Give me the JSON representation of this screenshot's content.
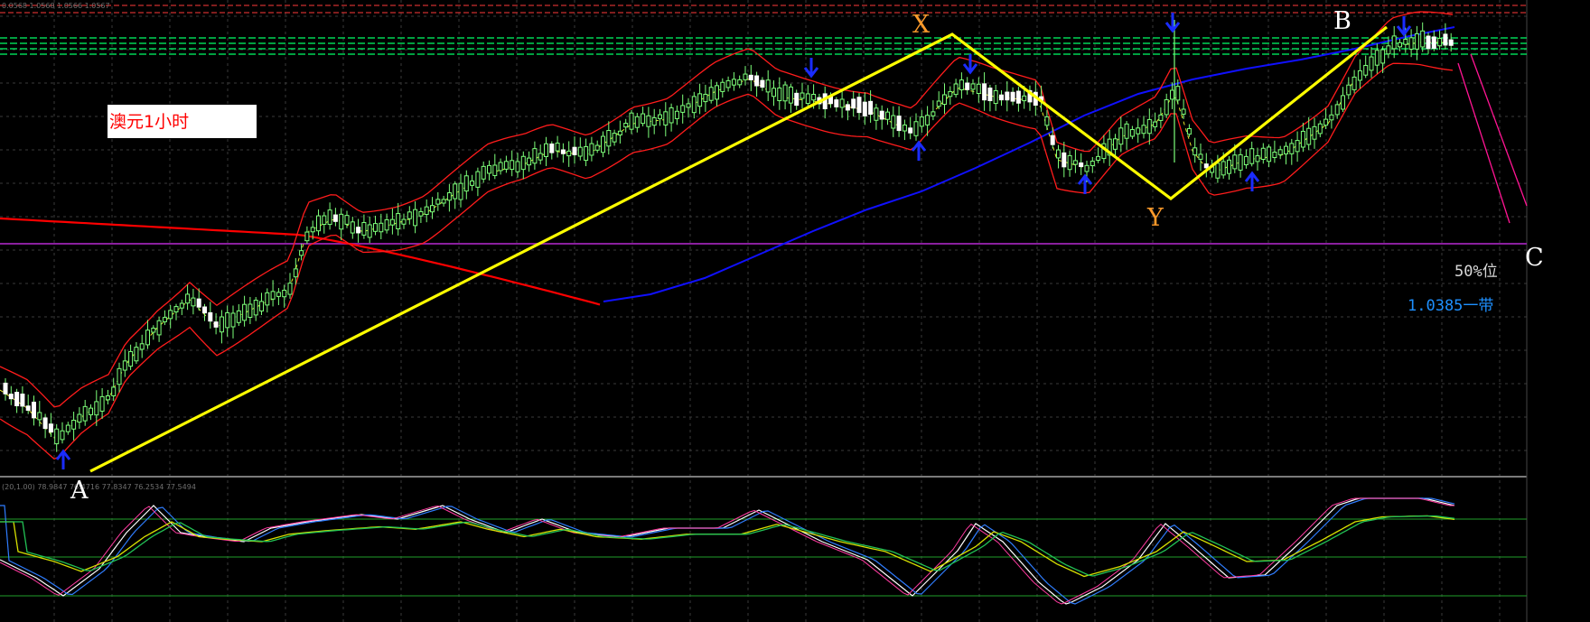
{
  "title": "澳元1小时",
  "header_values": "0.0568 1.0568 1.0566 1.0567",
  "indicator_header": "(20,1.00) 78.9847 76.4716 77.8347 76.2534 77.5494",
  "points": [
    {
      "label": "A",
      "color": "#ffffff"
    },
    {
      "label": "X",
      "color": "#ff9b2b"
    },
    {
      "label": "Y",
      "color": "#ff9b2b"
    },
    {
      "label": "B",
      "color": "#ffffff"
    },
    {
      "label": "C",
      "color": "#ffffff"
    }
  ],
  "notes": [
    {
      "text": "50%位",
      "color": "#d8d8d8"
    },
    {
      "text": "1.0385一带",
      "color": "#1e90ff"
    }
  ],
  "colors": {
    "background": "#000000",
    "bull_candle": "#7dff7a",
    "bear_candle": "#ffffff",
    "pattern_line": "#ffff00",
    "ma_long": "#ff0000",
    "ma_mid": "#1010ff",
    "band": "#ff1c1c",
    "projection": "#ff1493",
    "level_line": "#00ff66",
    "level_line_top": "#ff3a3a",
    "horizontal_50": "#8a1f9e",
    "arrow": "#1a2cff"
  },
  "chart_data": {
    "type": "candlestick",
    "instrument": "澳元",
    "timeframe": "1小时",
    "price_labels": {
      "mid_level": "1.0385"
    },
    "pattern": [
      "A",
      "X",
      "Y",
      "B",
      "C"
    ],
    "grid": true,
    "oscillator": {
      "type": "stochastic",
      "header": "(20,1.00) 78.9847 76.4716 77.8347 76.2534 77.5494"
    }
  }
}
